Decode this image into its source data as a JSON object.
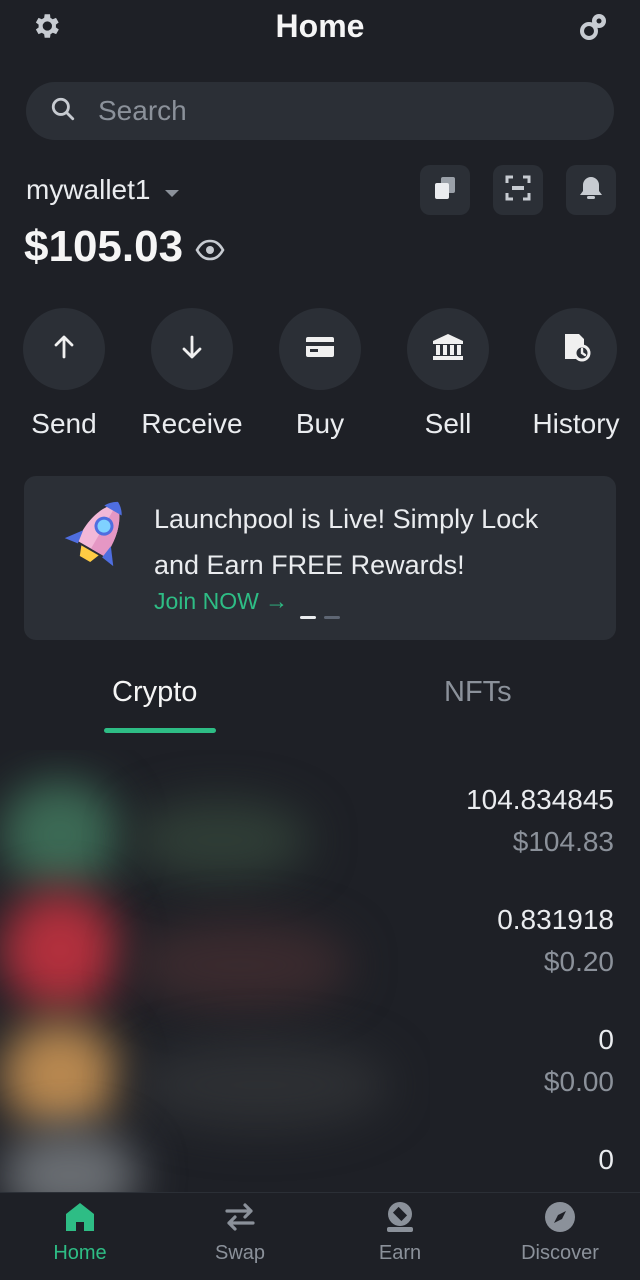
{
  "header": {
    "title": "Home"
  },
  "search": {
    "placeholder": "Search"
  },
  "wallet": {
    "name": "mywallet1",
    "balance": "$105.03"
  },
  "actions": [
    {
      "label": "Send",
      "icon": "arrow-up-icon"
    },
    {
      "label": "Receive",
      "icon": "arrow-down-icon"
    },
    {
      "label": "Buy",
      "icon": "card-icon"
    },
    {
      "label": "Sell",
      "icon": "bank-icon"
    },
    {
      "label": "History",
      "icon": "history-icon"
    }
  ],
  "banner": {
    "line1": "Launchpool is Live! Simply Lock",
    "line2": "and Earn FREE Rewards!",
    "cta": "Join NOW →"
  },
  "tabs": {
    "crypto": "Crypto",
    "nfts": "NFTs"
  },
  "assets": [
    {
      "amount": "104.834845",
      "value": "$104.83"
    },
    {
      "amount": "0.831918",
      "value": "$0.20"
    },
    {
      "amount": "0",
      "value": "$0.00"
    },
    {
      "amount": "0",
      "value": ""
    }
  ],
  "nav": {
    "home": "Home",
    "swap": "Swap",
    "earn": "Earn",
    "discover": "Discover"
  },
  "colors": {
    "accent": "#2ebd85",
    "background": "#1e2026",
    "surface": "#2b2f36",
    "muted": "#8b919a"
  }
}
